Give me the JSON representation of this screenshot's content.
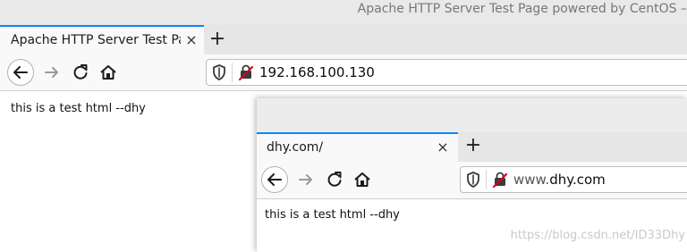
{
  "back_window": {
    "window_title": "Apache HTTP Server Test Page powered by CentOS –",
    "tab_title": "Apache HTTP Server Test Pag",
    "tab_close": "×",
    "new_tab": "+",
    "url": "192.168.100.130",
    "content": "this is a test html --dhy"
  },
  "front_window": {
    "tab_title": "dhy.com/",
    "tab_close": "×",
    "new_tab": "+",
    "url_prefix": "www.",
    "url_host": "dhy.com",
    "content": "this is a test html --dhy"
  },
  "watermark": "https://blog.csdn.net/ID33Dhy",
  "colors": {
    "tab_accent": "#0a84ff",
    "insecure_icon": "#d70022"
  }
}
